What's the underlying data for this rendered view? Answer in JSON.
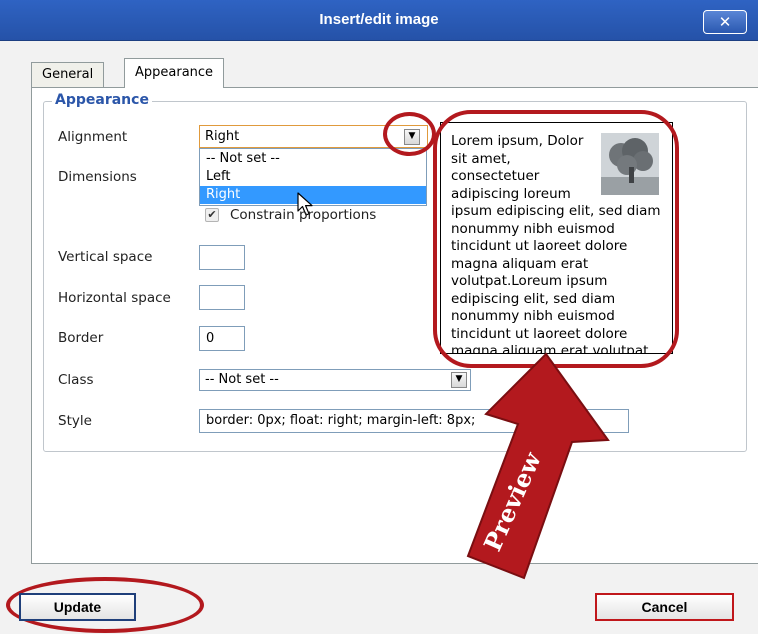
{
  "window": {
    "title": "Insert/edit image",
    "close_glyph": "✕"
  },
  "tabs": [
    {
      "label": "General",
      "active": false
    },
    {
      "label": "Appearance",
      "active": true
    }
  ],
  "fieldset_legend": "Appearance",
  "fields": {
    "alignment": {
      "label": "Alignment",
      "value": "Right",
      "options": [
        "-- Not set --",
        "Left",
        "Right"
      ],
      "highlighted_option": "Right"
    },
    "dimensions": {
      "label": "Dimensions",
      "constrain_label": "Constrain proportions",
      "constrain_checked": true
    },
    "vertical_space": {
      "label": "Vertical space",
      "value": ""
    },
    "horizontal_space": {
      "label": "Horizontal space",
      "value": ""
    },
    "border": {
      "label": "Border",
      "value": "0"
    },
    "class": {
      "label": "Class",
      "value": "-- Not set --"
    },
    "style": {
      "label": "Style",
      "value": "border: 0px; float: right; margin-left: 8px;"
    }
  },
  "preview_text": "Lorem ipsum, Dolor sit amet, consectetuer adipiscing loreum ipsum edipiscing elit, sed diam nonummy nibh euismod tincidunt ut laoreet dolore magna aliquam erat volutpat.Loreum ipsum edipiscing elit, sed diam nonummy nibh euismod tincidunt ut laoreet dolore magna aliquam erat volutpat.",
  "annotation": {
    "arrow_label": "Preview"
  },
  "buttons": {
    "update": "Update",
    "cancel": "Cancel"
  },
  "colors": {
    "title_bar": "#2a5bb5",
    "legend_text": "#2b56a9",
    "highlight": "#3399ff",
    "annotation_red": "#b3191e",
    "cancel_border": "#c0171b"
  }
}
